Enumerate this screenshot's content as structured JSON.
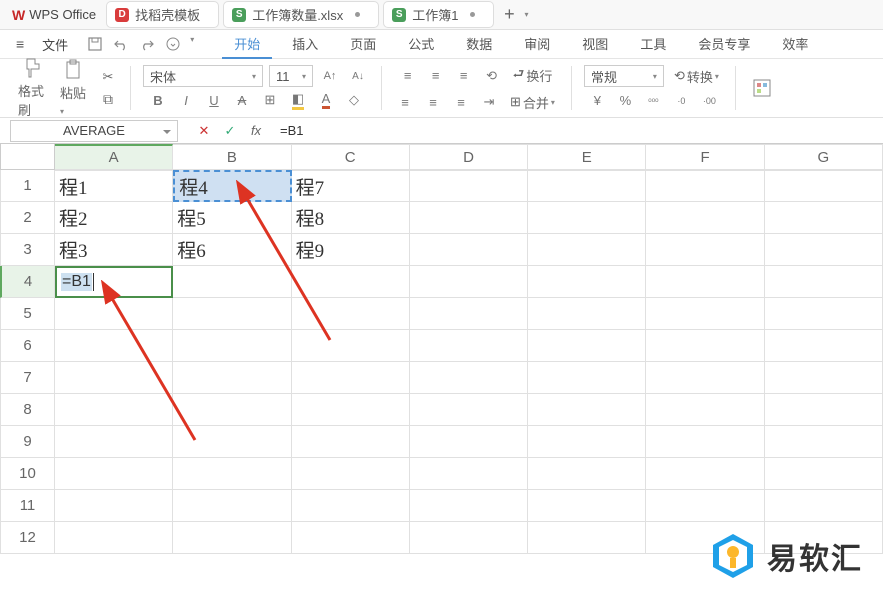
{
  "titlebar": {
    "brand": "WPS Office",
    "tabs": [
      {
        "icon": "D",
        "label": "找稻壳模板"
      },
      {
        "icon": "S",
        "label": "工作簿数量.xlsx"
      },
      {
        "icon": "S",
        "label": "工作簿1"
      }
    ],
    "plus": "+"
  },
  "menubar": {
    "hamburger": "≡",
    "file": "文件",
    "tabs": [
      "开始",
      "插入",
      "页面",
      "公式",
      "数据",
      "审阅",
      "视图",
      "工具",
      "会员专享",
      "效率"
    ],
    "active_index": 0
  },
  "ribbon": {
    "fmtbrush": "格式刷",
    "paste": "粘贴",
    "font_name": "宋体",
    "font_size": "11",
    "wrap": "换行",
    "merge": "合并",
    "general": "常规",
    "convert": "转换",
    "chev": "▾",
    "icons": {
      "brush": "⌂",
      "scissors": "✂",
      "copy": "⧉",
      "bold": "B",
      "italic": "I",
      "underline": "U",
      "strike": "A",
      "border": "⊞",
      "fill": "◧",
      "fontcolor": "A",
      "eraser": "◇",
      "aleft": "≡",
      "acenter": "≡",
      "aright": "≡",
      "atop": "≡",
      "amid": "≡",
      "abottom": "≡",
      "yen": "¥",
      "percent": "%",
      "comma": "ᵒᵒᵒ",
      "decminus": "₋₀",
      "decplus": "₊₀",
      "Ainc": "A↑",
      "Adec": "A↓"
    }
  },
  "formulabar": {
    "name": "AVERAGE",
    "cancel": "✕",
    "confirm": "✓",
    "fx": "fx",
    "formula": "=B1"
  },
  "grid": {
    "cols": [
      "A",
      "B",
      "C",
      "D",
      "E",
      "F",
      "G"
    ],
    "rows": [
      "1",
      "2",
      "3",
      "4",
      "5",
      "6",
      "7",
      "8",
      "9",
      "10",
      "11",
      "12"
    ],
    "active_col": "A",
    "active_row": "4",
    "data": {
      "r1": {
        "A": "程1",
        "B": "程4",
        "C": "程7"
      },
      "r2": {
        "A": "程2",
        "B": "程5",
        "C": "程8"
      },
      "r3": {
        "A": "程3",
        "B": "程6",
        "C": "程9"
      }
    },
    "edit_value": "=B1"
  },
  "watermark": {
    "text": "易软汇"
  }
}
